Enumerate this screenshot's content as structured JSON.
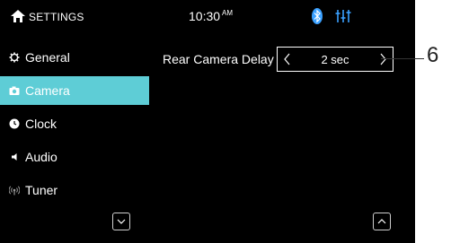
{
  "status_bar": {
    "title": "SETTINGS",
    "time": "10:30",
    "ampm": "AM",
    "icons": [
      "home-icon",
      "bluetooth-icon",
      "equalizer-icon"
    ],
    "bluetooth_color": "#3aa0ff"
  },
  "sidebar": {
    "items": [
      {
        "label": "General",
        "icon": "gear-icon",
        "active": false
      },
      {
        "label": "Camera",
        "icon": "camera-icon",
        "active": true
      },
      {
        "label": "Clock",
        "icon": "clock-icon",
        "active": false
      },
      {
        "label": "Audio",
        "icon": "speaker-icon",
        "active": false
      },
      {
        "label": "Tuner",
        "icon": "antenna-icon",
        "active": false
      }
    ],
    "active_color": "#5ecdd6"
  },
  "setting": {
    "label": "Rear Camera Delay",
    "value": "2 sec"
  },
  "callout": {
    "number": "6"
  }
}
